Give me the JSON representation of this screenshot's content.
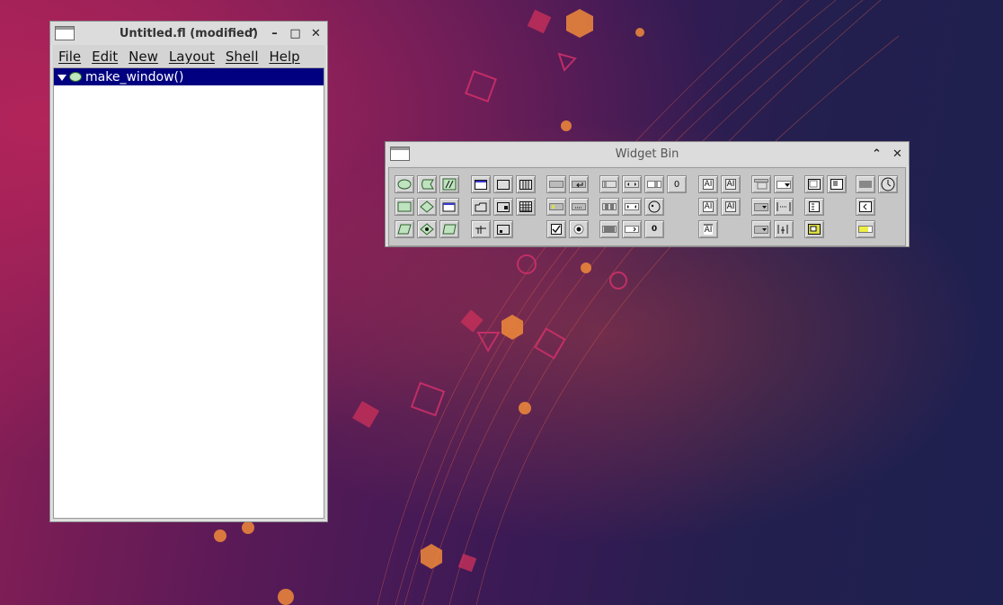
{
  "main_window": {
    "title": "Untitled.fl (modified)",
    "controls": {
      "minimize": "⌃",
      "iconify": "–",
      "maximize": "□",
      "close": "✕"
    },
    "menu": [
      "File",
      "Edit",
      "New",
      "Layout",
      "Shell",
      "Help"
    ],
    "tree": [
      {
        "label": "make_window()",
        "selected": true
      }
    ]
  },
  "widget_bin": {
    "title": "Widget Bin",
    "controls": {
      "minimize": "⌃",
      "close": "✕"
    },
    "label_tool_text": "AI",
    "value_text": "0",
    "icons": {
      "row1": [
        "function-icon",
        "code-icon",
        "comment-icon",
        "window-icon",
        "group-icon",
        "tabs-icon",
        "button-icon",
        "return-button-icon",
        "slider-icon",
        "scrollbar-icon",
        "value-slider-icon",
        "adjuster-icon",
        "input-icon",
        "output-icon",
        "menubar-icon",
        "choice-icon",
        "text-display-icon",
        "help-view-icon",
        "box-icon",
        "clock-icon"
      ],
      "row2": [
        "declaration-icon",
        "class-icon",
        "widget-class-icon",
        "pack-icon",
        "scroll-icon",
        "table-icon",
        "light-button-icon",
        "repeat-button-icon",
        "counter-icon",
        "spinner-icon",
        "dial-icon",
        "float-input-icon",
        "multiline-input-icon",
        "menu-button-icon",
        "check-browser-icon",
        "file-browser-icon",
        "tile-icon"
      ],
      "row3": [
        "code-block-icon",
        "data-icon",
        "declaration-block-icon",
        "tile-group-icon",
        "wizard-icon",
        "check-button-icon",
        "round-button-icon",
        "roller-icon",
        "value-input-icon",
        "value-output-icon",
        "file-input-icon",
        "input-choice-icon",
        "browser-icon",
        "tree-icon",
        "progress-icon"
      ]
    }
  }
}
